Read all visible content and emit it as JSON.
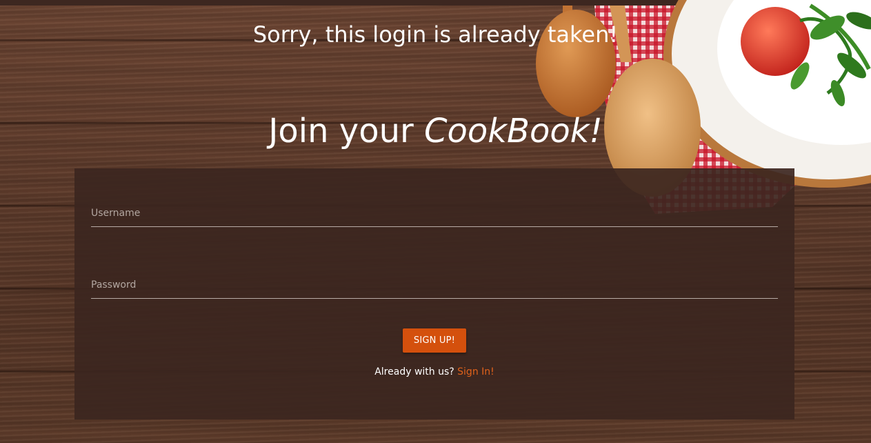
{
  "alert": {
    "message": "Sorry, this login is already taken!"
  },
  "header": {
    "title_prefix": "Join your ",
    "title_brand": "CookBook!"
  },
  "form": {
    "username_placeholder": "Username",
    "username_value": "",
    "password_placeholder": "Password",
    "password_value": "",
    "submit_label": "SIGN UP!",
    "existing_prompt": "Already with us?",
    "signin_link_label": "Sign In!"
  },
  "colors": {
    "accent": "#d4500d",
    "link": "#e0621b",
    "panel": "#3c2620",
    "wood": "#5a3a2a"
  },
  "icons": {
    "decor": [
      "wooden-spoon-icon",
      "wooden-spoon-icon",
      "checkered-napkin-icon",
      "salad-plate-icon"
    ]
  }
}
